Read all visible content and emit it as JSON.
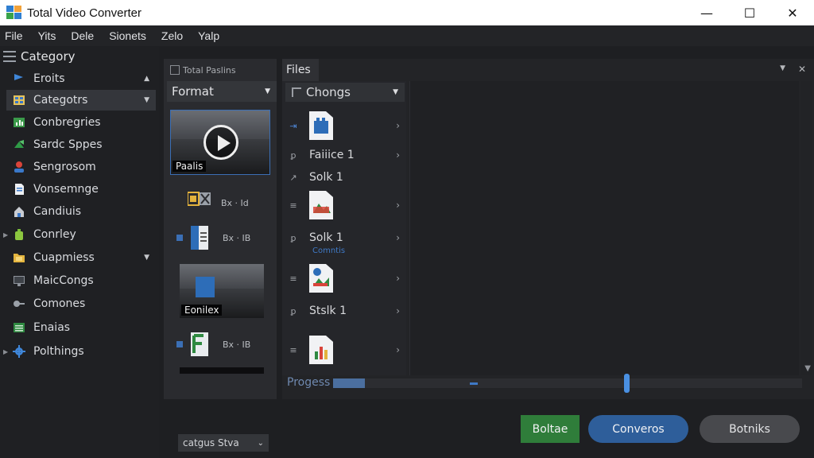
{
  "window": {
    "title": "Total Video Converter",
    "controls": {
      "minimize": "—",
      "maximize": "☐",
      "close": "✕"
    }
  },
  "menu": [
    "File",
    "Yits",
    "Dele",
    "Sionets",
    "Zelo",
    "Yalp"
  ],
  "sidebar": {
    "header": "Category",
    "items": [
      {
        "label": "Eroits",
        "icon": "flag-icon",
        "caret": "▲"
      },
      {
        "label": "Categotrs",
        "icon": "grid-icon",
        "caret": "▼",
        "active": true
      },
      {
        "label": "Conbregries",
        "icon": "chart-icon"
      },
      {
        "label": "Sardc Sppes",
        "icon": "share-icon"
      },
      {
        "label": "Sengrosom",
        "icon": "user-icon"
      },
      {
        "label": "Vonsemnge",
        "icon": "document-icon"
      },
      {
        "label": "Candiuis",
        "icon": "home-icon"
      },
      {
        "label": "Conrley",
        "icon": "bottle-icon",
        "expand": "▶"
      },
      {
        "label": "Cuapmiess",
        "icon": "folder-icon",
        "caret": "▼"
      },
      {
        "label": "MaicCongs",
        "icon": "monitor-icon"
      },
      {
        "label": "Comones",
        "icon": "key-icon"
      },
      {
        "label": "Enaias",
        "icon": "spreadsheet-icon"
      },
      {
        "label": "Polthings",
        "icon": "gear-icon",
        "expand": "▶"
      }
    ]
  },
  "format_panel": {
    "tab": "Total Paslins",
    "dropdown": "Format",
    "thumb1_caption": "Paalis",
    "thumb2_caption": "Eonilex",
    "rows": [
      {
        "code": "Bx · Id"
      },
      {
        "code": "Bx · IB"
      },
      {
        "code": "Bx · IB"
      }
    ],
    "bottom_dropdown": "catgus Stva"
  },
  "files_panel": {
    "tab": "Files",
    "pin": "▼",
    "close": "✕",
    "list_dropdown": "Chongs",
    "rows": [
      {
        "lead": "⇥",
        "label": "",
        "icon": "doc-blue-icon",
        "chev": "›"
      },
      {
        "lead": "ꝑ",
        "label": "Faiiice 1",
        "chev": "›"
      },
      {
        "lead": "↗",
        "label": "Solk 1"
      },
      {
        "lead": "≡",
        "label": "",
        "icon": "doc-image-icon",
        "chev": "›"
      },
      {
        "lead": "ꝑ",
        "label": "Solk 1",
        "sub": "Comntis",
        "chev": "›"
      },
      {
        "lead": "≡",
        "label": "",
        "icon": "doc-check-icon",
        "chev": "›"
      },
      {
        "lead": "ꝑ",
        "label": "Stslk 1",
        "chev": "›"
      },
      {
        "lead": "≡",
        "label": "",
        "icon": "doc-chart-icon",
        "chev": "›"
      }
    ],
    "scroll_down": "▼"
  },
  "progress": {
    "label": "Progess",
    "value": 0.62
  },
  "buttons": {
    "green": "Boltae",
    "blue": "Converos",
    "gray": "Botniks"
  },
  "colors": {
    "accent_blue": "#2e5e9a",
    "accent_green": "#2f7d3a",
    "progress_thumb": "#4a90e2"
  }
}
